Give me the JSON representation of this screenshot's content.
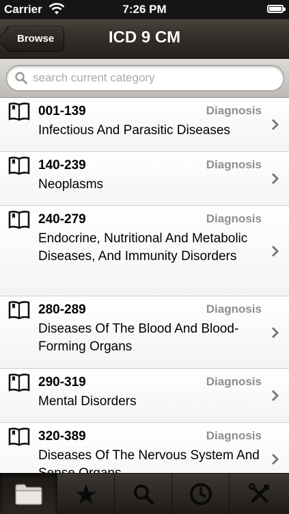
{
  "status_bar": {
    "carrier": "Carrier",
    "time": "7:26 PM"
  },
  "nav": {
    "back_label": "Browse",
    "title": "ICD 9 CM"
  },
  "search": {
    "placeholder": "search current category"
  },
  "list": {
    "items": [
      {
        "code": "001-139",
        "category": "Diagnosis",
        "title": "Infectious And Parasitic Diseases"
      },
      {
        "code": "140-239",
        "category": "Diagnosis",
        "title": "Neoplasms"
      },
      {
        "code": "240-279",
        "category": "Diagnosis",
        "title": "Endocrine, Nutritional And Metabolic Diseases, And Immunity Disorders"
      },
      {
        "code": "280-289",
        "category": "Diagnosis",
        "title": "Diseases Of The Blood And Blood-Forming Organs"
      },
      {
        "code": "290-319",
        "category": "Diagnosis",
        "title": "Mental Disorders"
      },
      {
        "code": "320-389",
        "category": "Diagnosis",
        "title": "Diseases Of The Nervous System And Sense Organs"
      }
    ]
  },
  "tab_bar": {
    "tabs": [
      {
        "icon": "folder-icon",
        "selected": true
      },
      {
        "icon": "star-icon",
        "selected": false
      },
      {
        "icon": "search-icon",
        "selected": false
      },
      {
        "icon": "clock-icon",
        "selected": false
      },
      {
        "icon": "tools-icon",
        "selected": false
      }
    ]
  },
  "colors": {
    "nav_bar": "#352f2a",
    "category_text": "#8e8e8e",
    "tab_bar": "#2a2622"
  }
}
